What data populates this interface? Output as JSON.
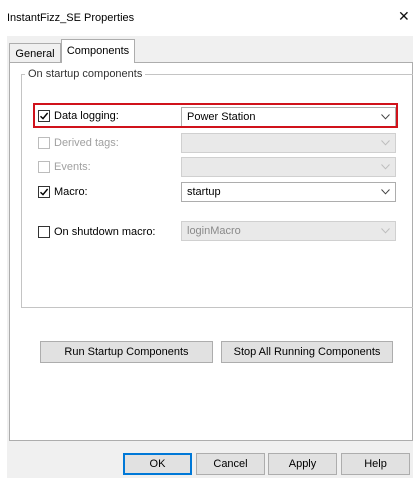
{
  "window": {
    "title": "InstantFizz_SE Properties",
    "close_glyph": "✕"
  },
  "tabs": [
    {
      "label": "General",
      "selected": false
    },
    {
      "label": "Components",
      "selected": true
    }
  ],
  "startup_group": {
    "label": "On startup components",
    "rows": [
      {
        "label": "Data logging:",
        "checked": true,
        "enabled": true,
        "value": "Power Station",
        "highlighted": true
      },
      {
        "label": "Derived tags:",
        "checked": false,
        "enabled": false,
        "value": ""
      },
      {
        "label": "Events:",
        "checked": false,
        "enabled": false,
        "value": ""
      },
      {
        "label": "Macro:",
        "checked": true,
        "enabled": true,
        "value": "startup"
      }
    ]
  },
  "shutdown": {
    "label": "On shutdown macro:",
    "checked": false,
    "enabled": false,
    "value": "loginMacro"
  },
  "actions": {
    "run_startup": "Run Startup Components",
    "stop_all": "Stop All Running Components"
  },
  "footer": {
    "ok": "OK",
    "cancel": "Cancel",
    "apply": "Apply",
    "help": "Help"
  },
  "colors": {
    "highlight": "#d0121b",
    "default_button_border": "#0078d7"
  }
}
